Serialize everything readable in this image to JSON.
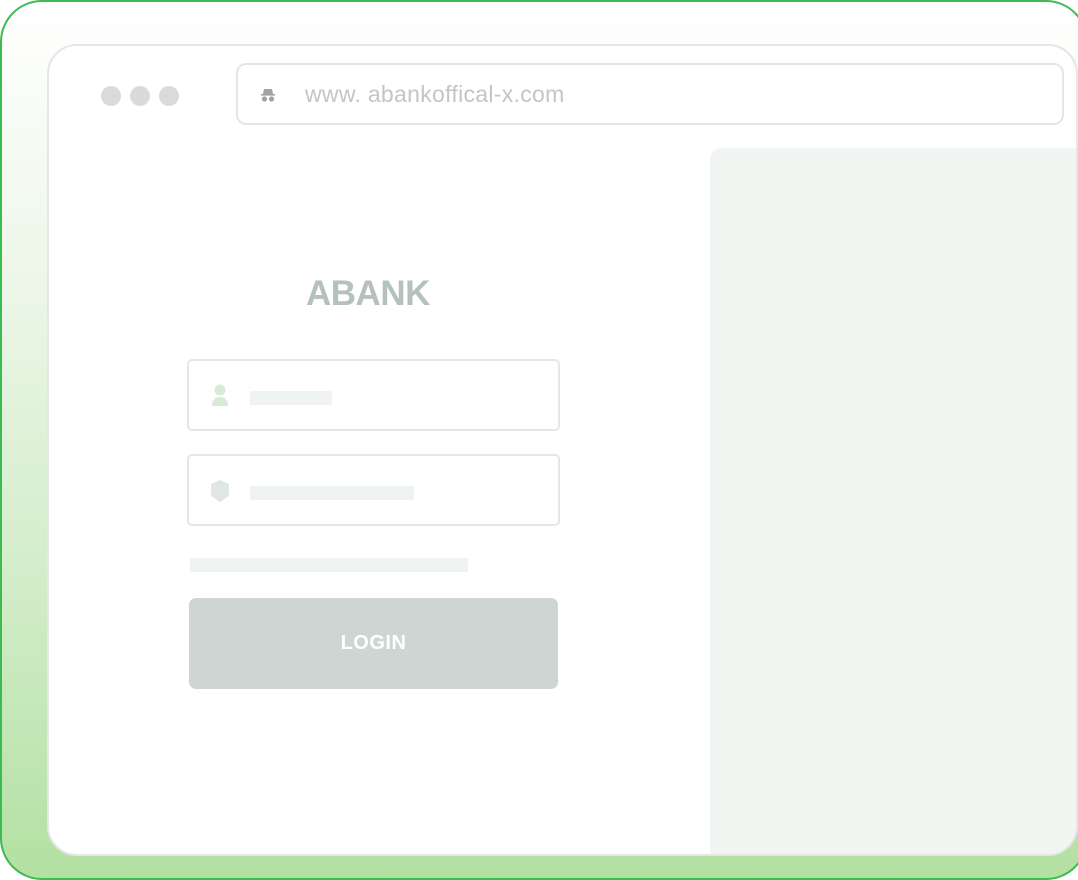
{
  "browser": {
    "url": "www. abankoffical-x.com",
    "address_icon": "incognito-icon"
  },
  "login": {
    "brand": "ABANK",
    "username_icon": "user-icon",
    "password_icon": "shield-icon",
    "button_label": "LOGIN"
  },
  "colors": {
    "frame_border": "#3dbb53",
    "frame_gradient_bottom": "#b3e0a3",
    "brand": "#b4c1bc",
    "button": "#ced6d4",
    "side_panel": "#f1f6f2"
  }
}
